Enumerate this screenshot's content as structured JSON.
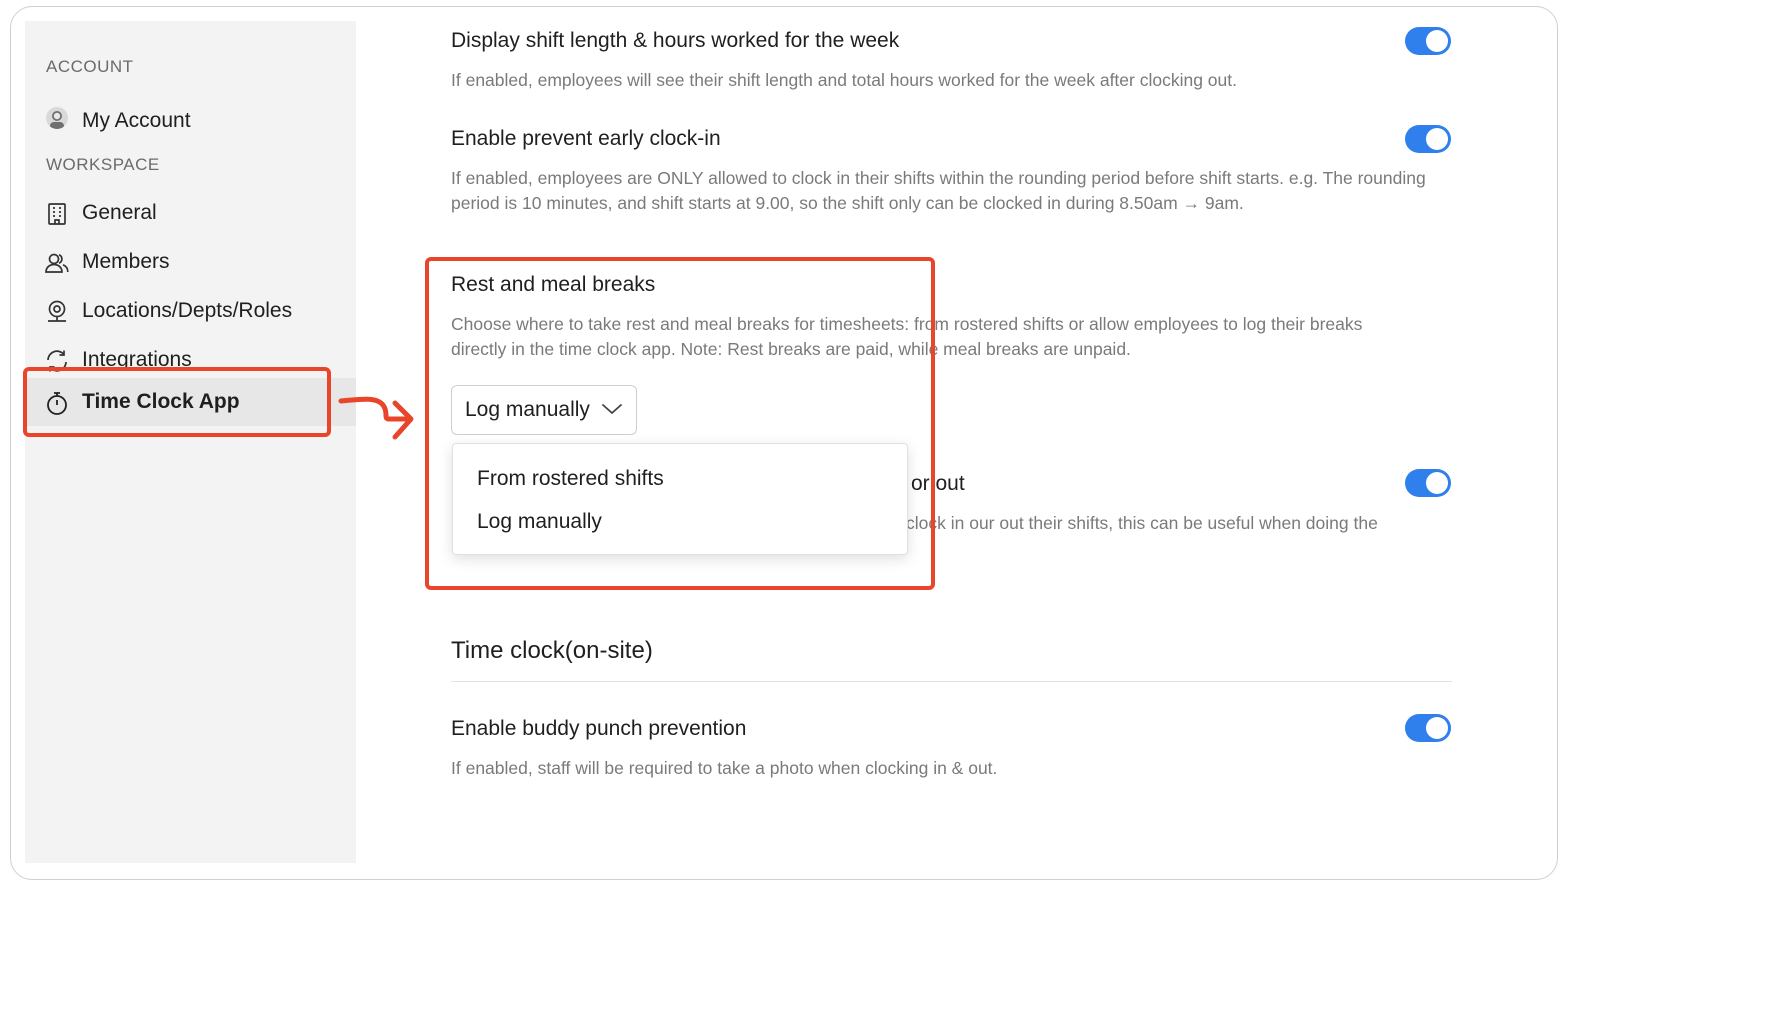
{
  "sidebar": {
    "account_label": "ACCOUNT",
    "my_account": "My Account",
    "workspace_label": "WORKSPACE",
    "items": [
      {
        "label": "General",
        "icon": "building-icon"
      },
      {
        "label": "Members",
        "icon": "members-icon"
      },
      {
        "label": "Locations/Depts/Roles",
        "icon": "location-pin-icon"
      },
      {
        "label": "Integrations",
        "icon": "sync-icon"
      },
      {
        "label": "Time Clock App",
        "icon": "stopwatch-icon",
        "active": true
      }
    ]
  },
  "settings": {
    "shift_length": {
      "title": "Display shift length & hours worked for the week",
      "desc": "If enabled, employees will see their shift length and total hours worked for the week after clocking out.",
      "enabled": true
    },
    "early_clockin": {
      "title": "Enable prevent early clock-in",
      "desc": "If enabled, employees are ONLY allowed to clock in their shifts within the rounding period before shift starts. e.g. The rounding period is 10 minutes, and shift starts at 9.00, so the shift only can be clocked in during 8.50am → 9am.",
      "enabled": true
    },
    "breaks": {
      "title": "Rest and meal breaks",
      "desc": "Choose where to take rest and meal breaks for timesheets: from rostered shifts or allow employees to log their breaks directly in the time clock app. Note: Rest breaks are paid, while meal breaks are unpaid.",
      "selected": "Log manually",
      "options": [
        "From rostered shifts",
        "Log manually"
      ]
    },
    "hidden_setting": {
      "title_fragment": "or out",
      "desc_fragment": "clock in our out their shifts, this can be useful when doing the",
      "enabled": true
    }
  },
  "onsite": {
    "heading": "Time clock(on-site)",
    "buddy_punch": {
      "title": "Enable buddy punch prevention",
      "desc": "If enabled, staff will be required to take a photo when clocking in & out.",
      "enabled": true
    }
  },
  "colors": {
    "toggle_on": "#2f80ed",
    "highlight": "#e8452a",
    "sidebar_bg": "#f3f3f3"
  }
}
